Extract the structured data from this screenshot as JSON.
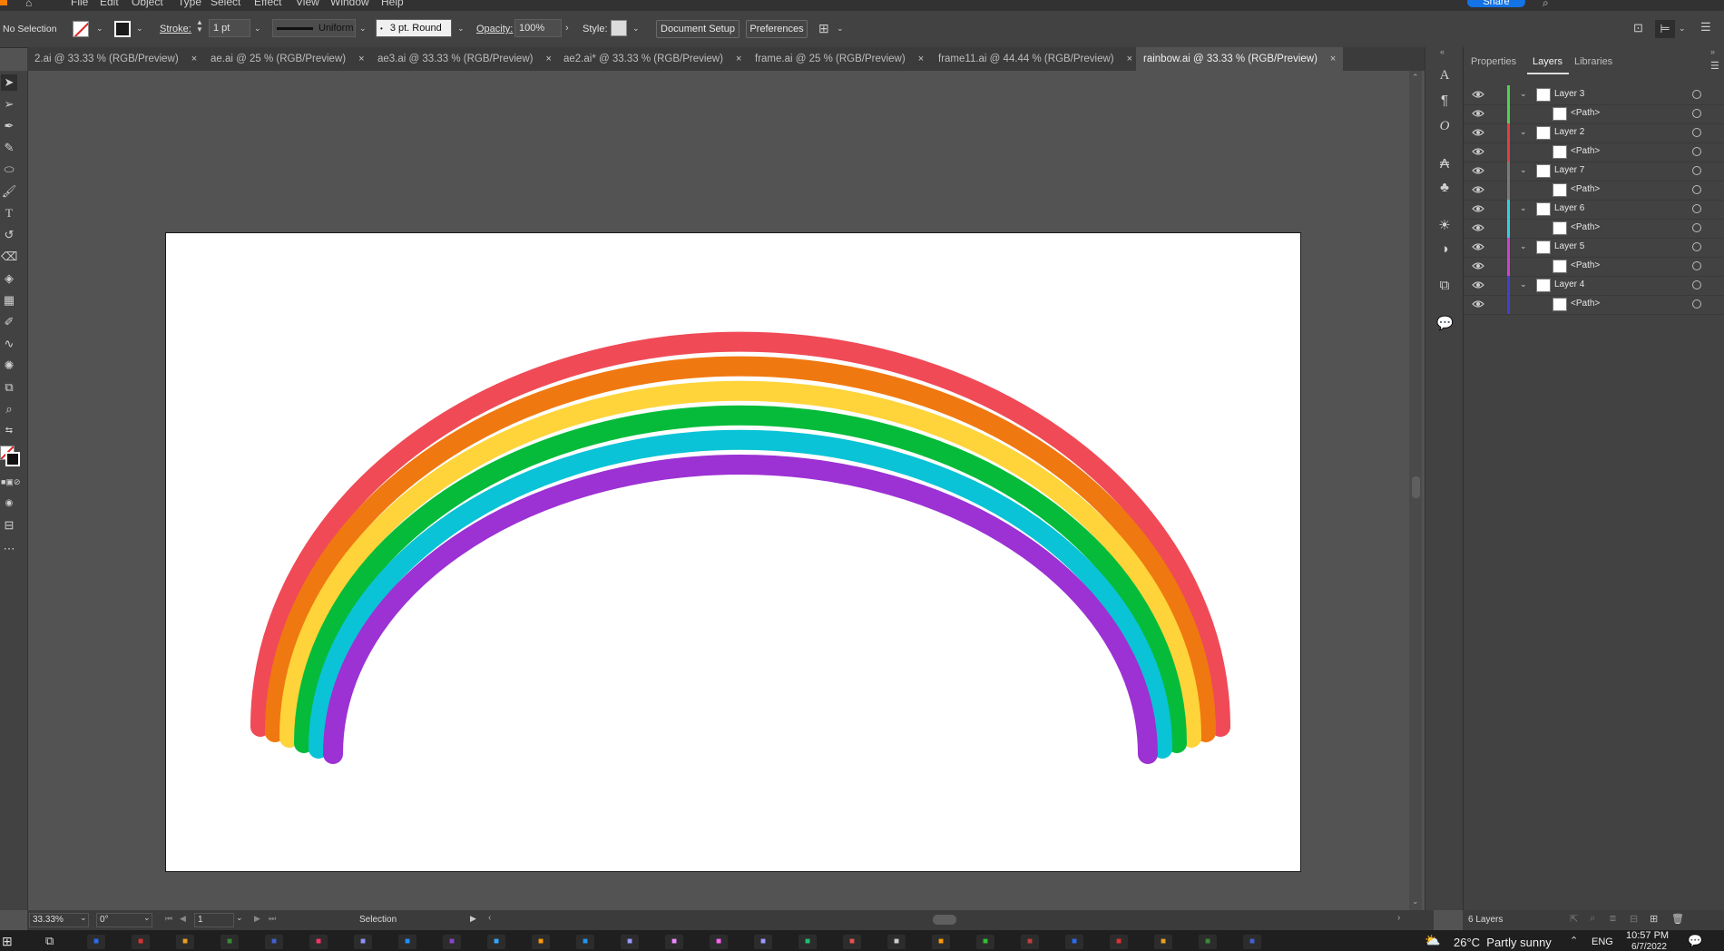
{
  "menubar": {
    "items": [
      "File",
      "Edit",
      "Object",
      "Type",
      "Select",
      "Effect",
      "View",
      "Window",
      "Help"
    ],
    "share_label": "Share"
  },
  "control_bar": {
    "selection_status": "No Selection",
    "stroke_label": "Stroke:",
    "stroke_weight": "1 pt",
    "stroke_profile": "Uniform",
    "brush": "3 pt. Round",
    "opacity_label": "Opacity:",
    "opacity_value": "100%",
    "style_label": "Style:",
    "document_setup": "Document Setup",
    "preferences": "Preferences"
  },
  "tabs": [
    {
      "label": "2.ai @ 33.33 % (RGB/Preview)",
      "active": false
    },
    {
      "label": "ae.ai @ 25 % (RGB/Preview)",
      "active": false
    },
    {
      "label": "ae3.ai @ 33.33 % (RGB/Preview)",
      "active": false
    },
    {
      "label": "ae2.ai* @ 33.33 % (RGB/Preview)",
      "active": false
    },
    {
      "label": "frame.ai @ 25 % (RGB/Preview)",
      "active": false
    },
    {
      "label": "frame11.ai @ 44.44 % (RGB/Preview)",
      "active": false
    },
    {
      "label": "rainbow.ai @ 33.33 % (RGB/Preview)",
      "active": true
    }
  ],
  "tab_close_glyph": "×",
  "rainbow": {
    "colors": [
      "#f04a57",
      "#f07810",
      "#fed43a",
      "#06bb3a",
      "#0ac3d6",
      "#9c31d4"
    ]
  },
  "status_bar": {
    "zoom": "33.33%",
    "rotation": "0°",
    "artboard": "1",
    "tool": "Selection"
  },
  "panel": {
    "tabs": [
      "Properties",
      "Layers",
      "Libraries"
    ],
    "active_tab": "Layers",
    "layers": [
      {
        "name": "Layer 3",
        "color": "#4dd44d",
        "child": "<Path>"
      },
      {
        "name": "Layer 2",
        "color": "#e04040",
        "child": "<Path>"
      },
      {
        "name": "Layer 7",
        "color": "#7a7a7a",
        "child": "<Path>"
      },
      {
        "name": "Layer 6",
        "color": "#30d0e0",
        "child": "<Path>"
      },
      {
        "name": "Layer 5",
        "color": "#d040d0",
        "child": "<Path>"
      },
      {
        "name": "Layer 4",
        "color": "#4040d8",
        "child": "<Path>"
      }
    ],
    "footer_count": "6 Layers"
  },
  "taskbar": {
    "apps": [
      "Ai",
      "Id",
      "Ae",
      "R",
      "Lr",
      "Ps",
      "Ai",
      "Pr",
      "Xd",
      "Ae",
      "U",
      "Ai"
    ],
    "weather": "26°C  Partly sunny",
    "language": "ENG",
    "time": "10:57 PM",
    "date": "6/7/2022"
  }
}
